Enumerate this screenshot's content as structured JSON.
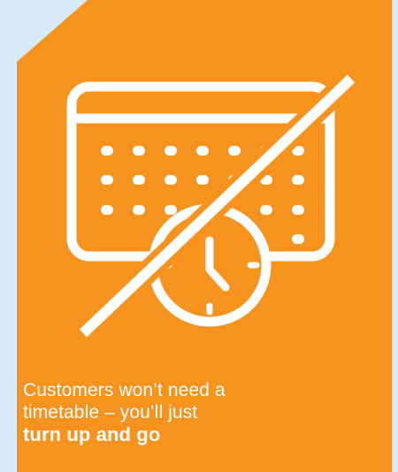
{
  "colors": {
    "background": "#d7ecf8",
    "card": "#f6921e",
    "foreground": "#ffffff"
  },
  "icon": {
    "name": "no-timetable-calendar-clock-icon"
  },
  "caption": {
    "line1": "Customers won’t need a",
    "line2": "timetable – you’ll just",
    "emphasis": "turn up and go"
  }
}
